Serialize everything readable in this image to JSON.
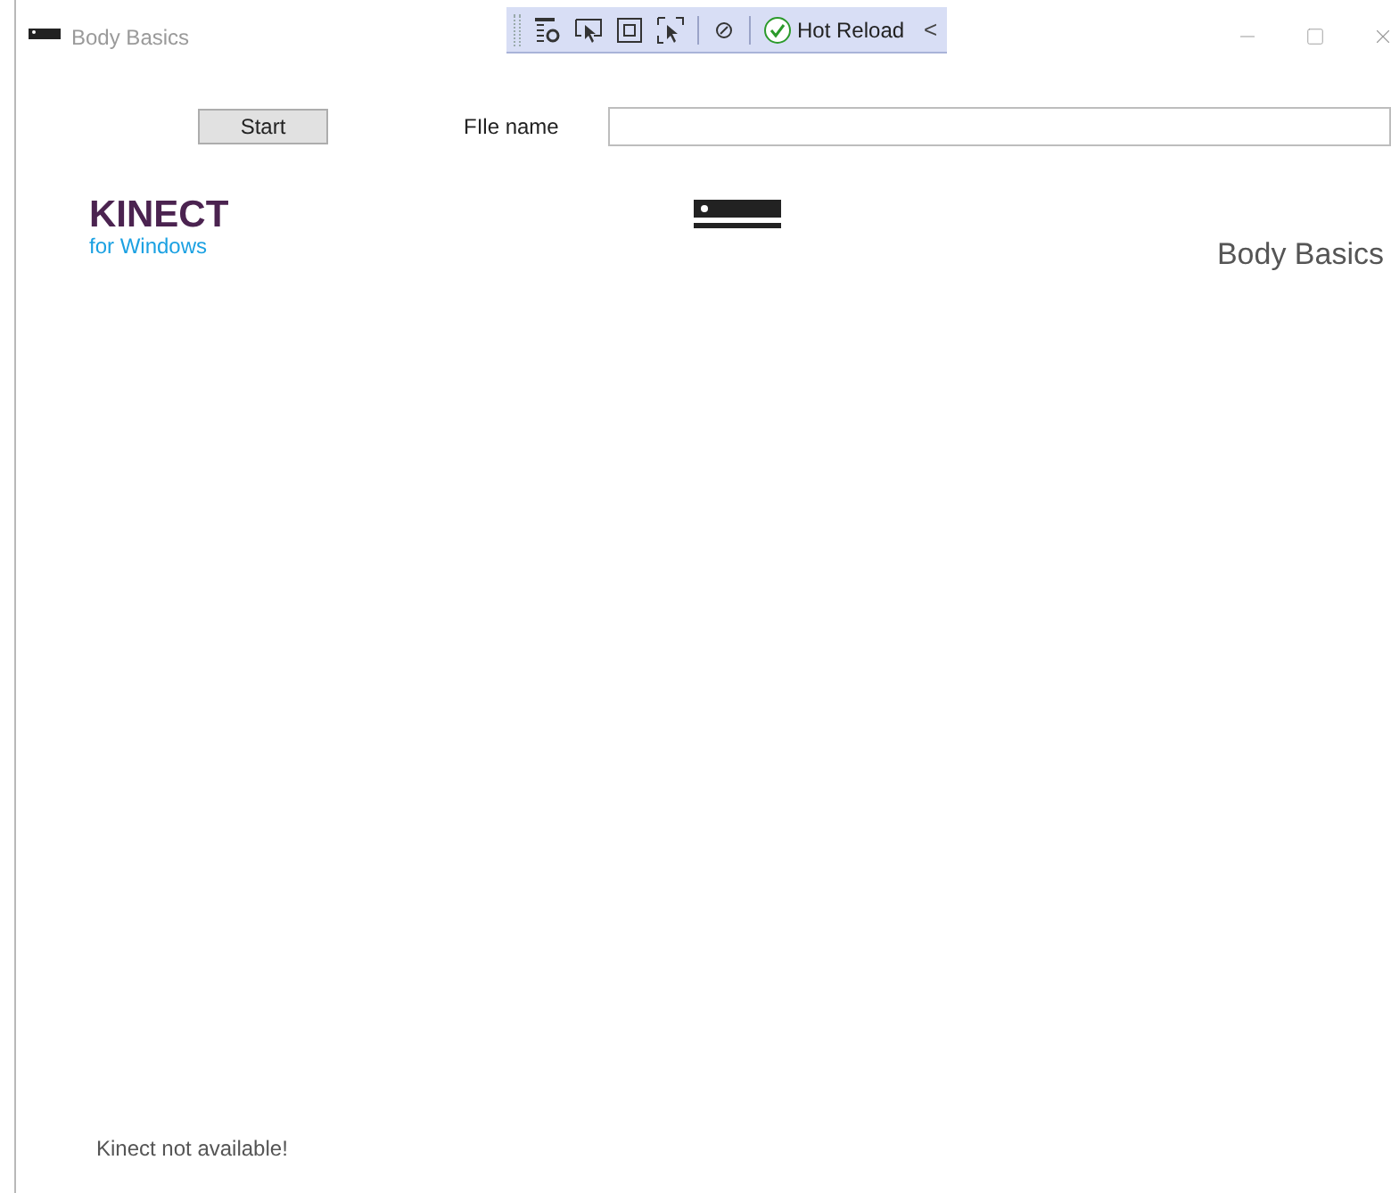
{
  "window": {
    "title": "Body Basics"
  },
  "debug_toolbar": {
    "hot_reload": "Hot Reload",
    "collapse": "<"
  },
  "start_button": "Start",
  "file_field": {
    "label": "FIle name"
  },
  "logo": {
    "brand": "KINECT",
    "subtitle": "for Windows"
  },
  "app_title": "Body Basics",
  "status": "Kinect not available!"
}
